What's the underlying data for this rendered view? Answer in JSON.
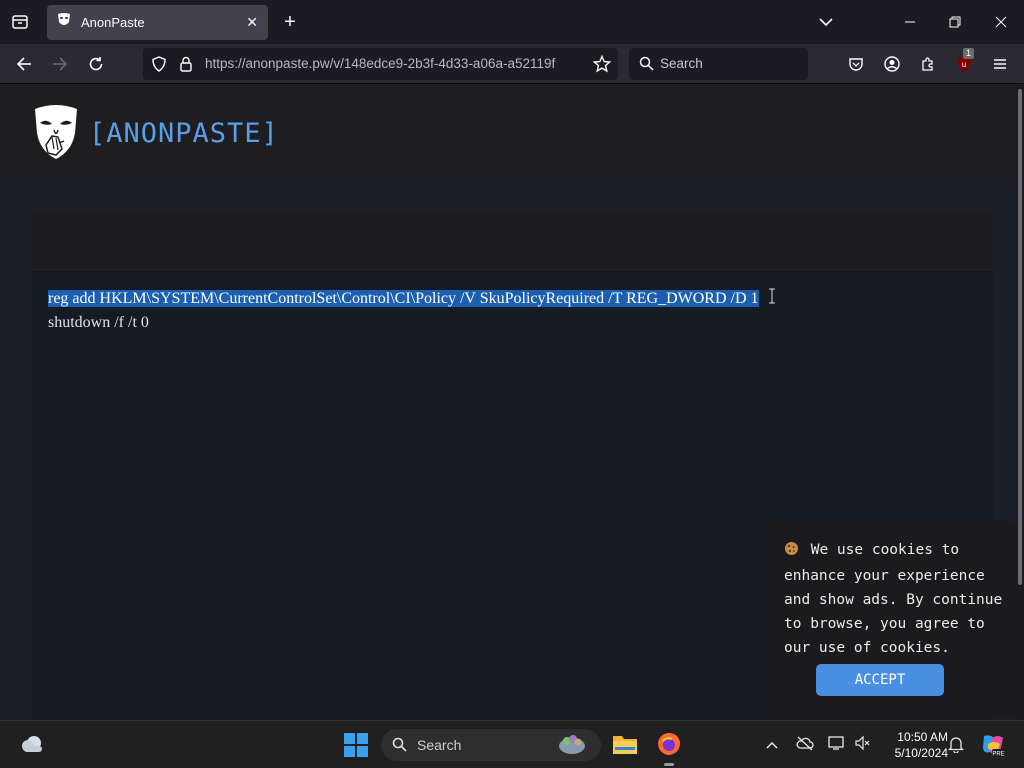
{
  "browser": {
    "tab": {
      "title": "AnonPaste"
    },
    "url": "https://anonpaste.pw/v/148edce9-2b3f-4d33-a06a-a52119f",
    "search_placeholder": "Search",
    "extension_badge": "1"
  },
  "site": {
    "logo_text": "[ANONPASTE]",
    "paste_lines": {
      "line1": "reg add HKLM\\SYSTEM\\CurrentControlSet\\Control\\CI\\Policy /V SkuPolicyRequired /T REG_DWORD /D 1",
      "line2": "shutdown /f /t 0"
    }
  },
  "cookie_banner": {
    "icon": "cookie-icon",
    "message": "We use cookies to enhance your experience and show ads. By continue to browse, you agree to our use of cookies.",
    "accept_label": "ACCEPT"
  },
  "taskbar": {
    "search_label": "Search",
    "time": "10:50 AM",
    "date": "5/10/2024"
  },
  "colors": {
    "accent": "#5b9ee8",
    "selection": "#1c5fb1",
    "button": "#4a90e2"
  }
}
